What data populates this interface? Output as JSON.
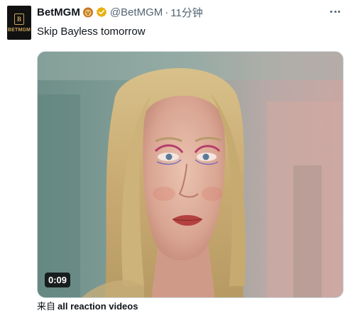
{
  "tweet": {
    "display_name": "BetMGM",
    "emoji": "🦁",
    "handle": "@BetMGM",
    "separator": "·",
    "time": "11分钟",
    "text": "Skip Bayless tomorrow"
  },
  "avatar": {
    "logo_text": "BETMGM"
  },
  "media": {
    "duration": "0:09"
  },
  "source": {
    "prefix": "来自",
    "link_label": "all reaction videos"
  },
  "colors": {
    "brand_gold": "#c7a35a",
    "secondary_text": "#536471",
    "verified": "#e8b00c"
  },
  "icons": {
    "more": "more-icon",
    "verified": "verified-icon",
    "lion": "lion-icon"
  }
}
